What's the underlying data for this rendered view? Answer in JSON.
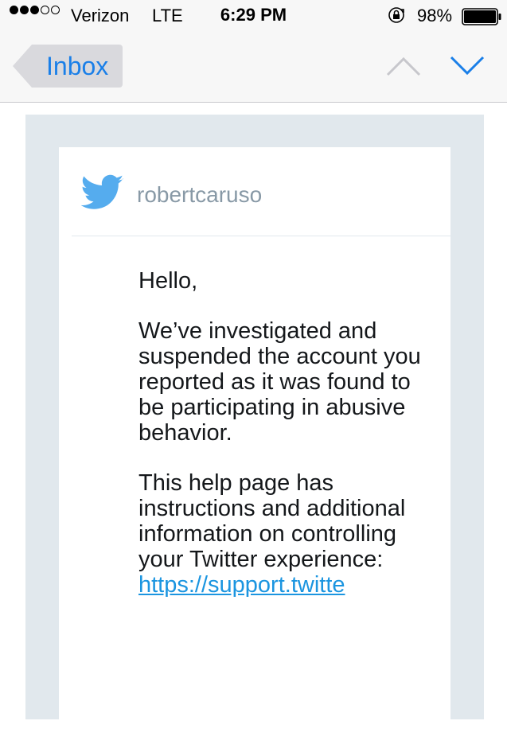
{
  "status_bar": {
    "carrier": "Verizon",
    "network": "LTE",
    "time": "6:29 PM",
    "battery_percent": "98%",
    "signal_bars_filled": 3,
    "signal_bars_total": 5,
    "battery_level": 0.98
  },
  "nav": {
    "back_label": "Inbox",
    "up_icon": "chevron-up-icon",
    "down_icon": "chevron-down-icon"
  },
  "email": {
    "sender": "robertcaruso",
    "sender_icon": "twitter-bird-icon",
    "greeting": "Hello,",
    "paragraph1": "We’ve investigated and suspended the account you reported as it was found to be participating in abusive behavior.",
    "paragraph2": "This help page has instructions and additional information on controlling your Twitter experience:",
    "link_text": "https://support.twitte"
  },
  "colors": {
    "accent": "#1a7fe8",
    "twitter_blue": "#55acee",
    "frame": "#e1e8ed",
    "sender_gray": "#8899a6",
    "link": "#1b95e0"
  }
}
